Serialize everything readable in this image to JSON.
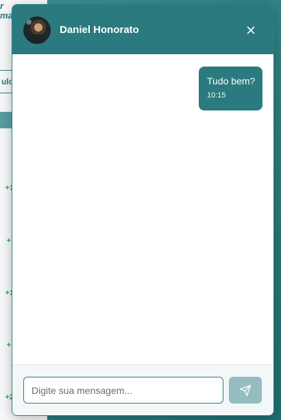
{
  "background_page": {
    "heading_fragment": "r\nma",
    "tab_fragment": "ulo",
    "values": [
      "+1",
      "+",
      "+1",
      "+",
      "+2"
    ]
  },
  "chat": {
    "contact_name": "Daniel Honorato",
    "avatar_icon": "contact-photo",
    "close_icon": "close-icon",
    "messages": [
      {
        "text": "Tudo bem?",
        "time": "10:15",
        "direction": "sent"
      }
    ],
    "composer": {
      "placeholder": "Digite sua mensagem...",
      "value": "",
      "send_icon": "send-icon"
    }
  },
  "colors": {
    "brand": "#2b7a7f",
    "send_button_disabled": "#95bdc1",
    "positive_value": "#27a56a"
  }
}
